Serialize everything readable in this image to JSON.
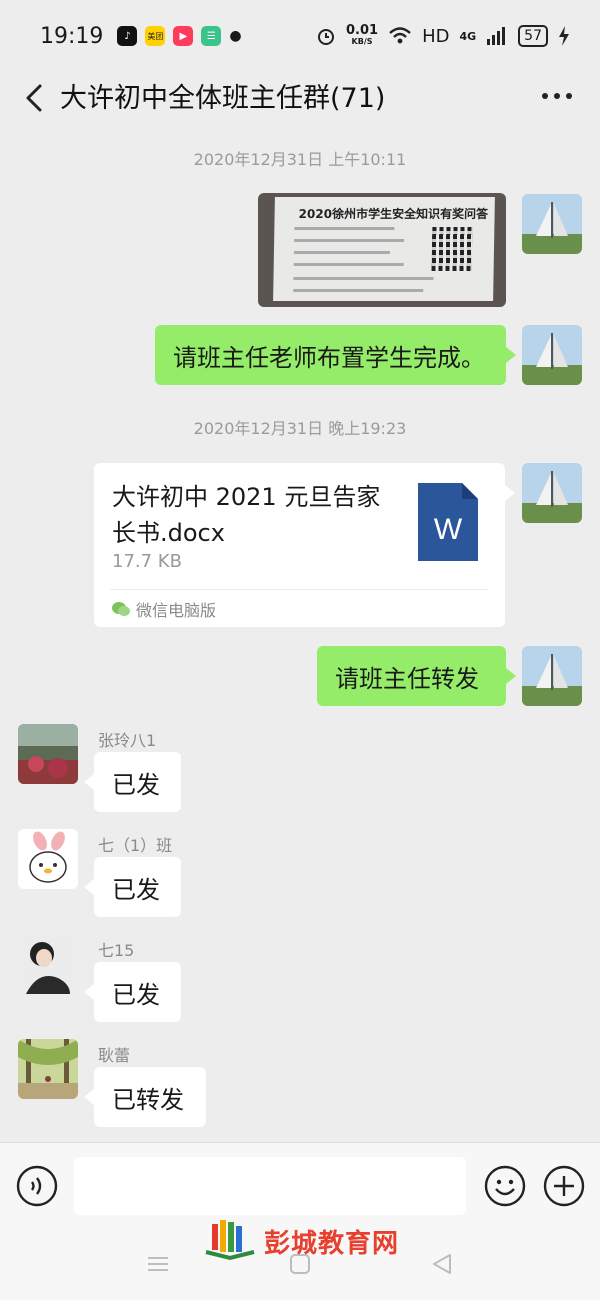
{
  "status_bar": {
    "time": "19:19",
    "app_icons": [
      "tiktok-icon",
      "meituan-icon",
      "video-app-icon",
      "store-app-icon"
    ],
    "meituan_label": "美团",
    "net_speed_value": "0.01",
    "net_speed_unit": "KB/S",
    "hd": "HD",
    "network": "4G",
    "battery": "57"
  },
  "header": {
    "title": "大许初中全体班主任群(71)"
  },
  "messages": {
    "timestamp_1": "2020年12月31日 上午10:11",
    "image_caption": "2020徐州市学生安全知识有奖问答",
    "text_1": "请班主任老师布置学生完成。",
    "timestamp_2": "2020年12月31日 晚上19:23",
    "file": {
      "name": "大许初中 2021 元旦告家长书.docx",
      "size": "17.7 KB",
      "source": "微信电脑版",
      "icon_letter": "W"
    },
    "text_2": "请班主任转发",
    "replies": [
      {
        "sender": "张玲八1",
        "text": "已发"
      },
      {
        "sender": "七（1）班",
        "text": "已发"
      },
      {
        "sender": "七15",
        "text": "已发"
      },
      {
        "sender": "耿蕾",
        "text": "已转发"
      }
    ]
  },
  "input_bar": {
    "placeholder": ""
  },
  "watermark": {
    "text": "彭城教育网"
  },
  "colors": {
    "background": "#ededed",
    "outgoing_bubble": "#95ec69",
    "incoming_bubble": "#ffffff",
    "word_blue": "#2b579a",
    "watermark_red": "#e8402f"
  }
}
